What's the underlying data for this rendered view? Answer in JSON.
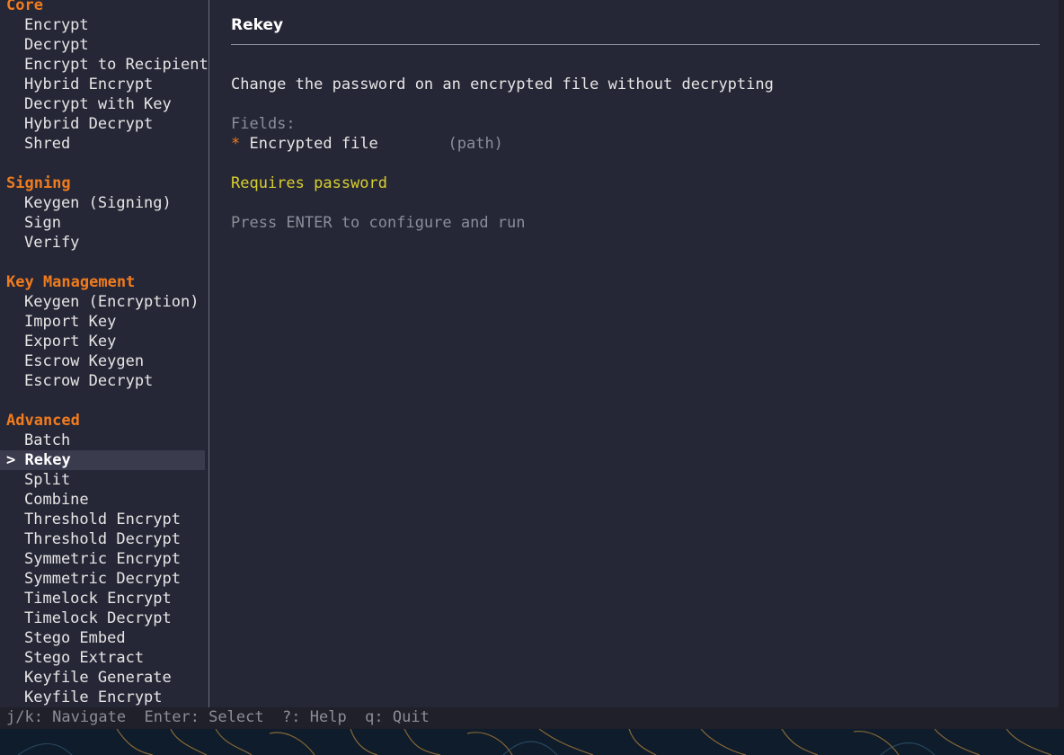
{
  "sidebar": {
    "sections": [
      {
        "title": "Core",
        "items": [
          "Encrypt",
          "Decrypt",
          "Encrypt to Recipient",
          "Hybrid Encrypt",
          "Decrypt with Key",
          "Hybrid Decrypt",
          "Shred"
        ]
      },
      {
        "title": "Signing",
        "items": [
          "Keygen (Signing)",
          "Sign",
          "Verify"
        ]
      },
      {
        "title": "Key Management",
        "items": [
          "Keygen (Encryption)",
          "Import Key",
          "Export Key",
          "Escrow Keygen",
          "Escrow Decrypt"
        ]
      },
      {
        "title": "Advanced",
        "items": [
          "Batch",
          "Rekey",
          "Split",
          "Combine",
          "Threshold Encrypt",
          "Threshold Decrypt",
          "Symmetric Encrypt",
          "Symmetric Decrypt",
          "Timelock Encrypt",
          "Timelock Decrypt",
          "Stego Embed",
          "Stego Extract",
          "Keyfile Generate",
          "Keyfile Encrypt"
        ]
      }
    ],
    "selected_marker": ">"
  },
  "detail": {
    "title": "Rekey",
    "description": "Change the password on an encrypted file without decrypting",
    "fields_label": "Fields:",
    "required_marker": "*",
    "field_name": "Encrypted file",
    "field_type": "(path)",
    "requirement": "Requires password",
    "hint": "Press ENTER to configure and run"
  },
  "statusbar": {
    "text": "j/k: Navigate  Enter: Select  ?: Help  q: Quit"
  },
  "colors": {
    "background": "#262736",
    "section_title": "#f07b1e",
    "warning": "#d8cf2e",
    "muted": "#8b8d99",
    "selected_bg": "#3a3c4e"
  }
}
